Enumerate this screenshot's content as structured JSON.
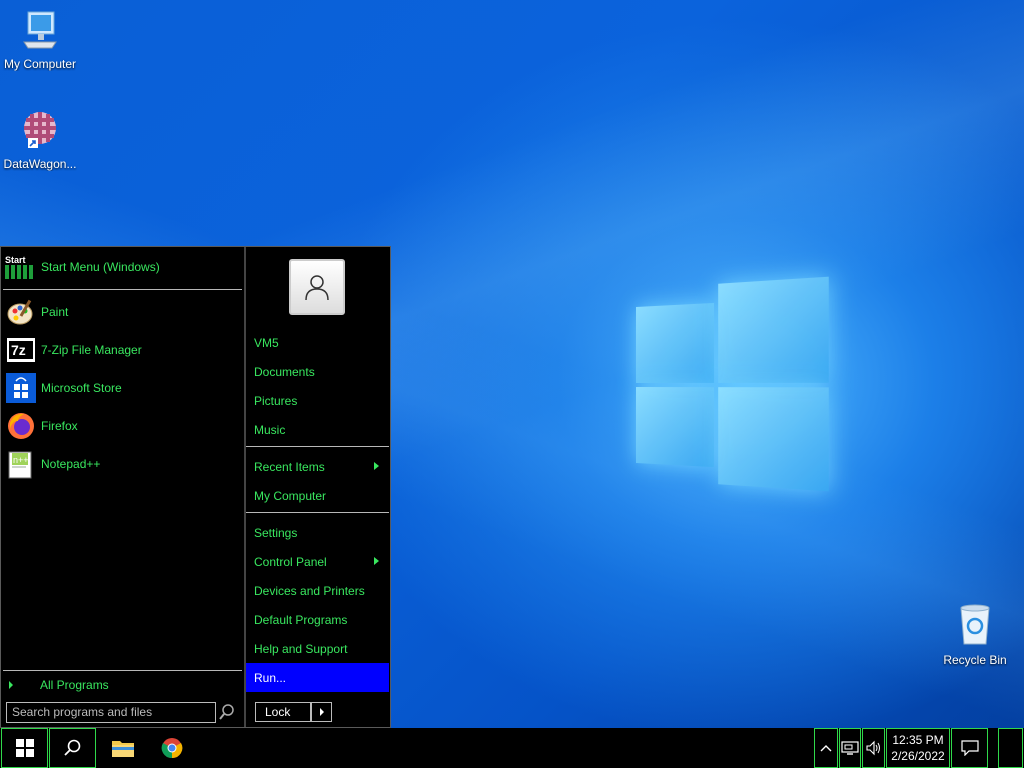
{
  "desktop": {
    "icons": [
      {
        "label": "My Computer",
        "icon": "computer-icon"
      },
      {
        "label": "DataWagon...",
        "icon": "datawagon-shortcut-icon"
      },
      {
        "label": "Recycle Bin",
        "icon": "recycle-bin-icon"
      }
    ]
  },
  "start_menu": {
    "header": {
      "icon_text": "Start",
      "label": "Start Menu (Windows)"
    },
    "pinned": [
      {
        "label": "Paint",
        "icon": "paint-icon"
      },
      {
        "label": "7-Zip File Manager",
        "icon": "7zip-icon"
      },
      {
        "label": "Microsoft Store",
        "icon": "store-icon"
      },
      {
        "label": "Firefox",
        "icon": "firefox-icon"
      },
      {
        "label": "Notepad++",
        "icon": "notepadpp-icon"
      }
    ],
    "all_programs": "All Programs",
    "search": {
      "placeholder": "Search programs and files"
    },
    "user": {
      "name": "VM5"
    },
    "right_items": [
      "Documents",
      "Pictures",
      "Music",
      "Recent Items",
      "My Computer",
      "Settings",
      "Control Panel",
      "Devices and Printers",
      "Default Programs",
      "Help and Support",
      "Run..."
    ],
    "lock_label": "Lock",
    "colors": {
      "text": "#39e75f",
      "highlight": "#0000ff",
      "background": "#000000"
    }
  },
  "taskbar": {
    "apps": [
      "start-button",
      "search-icon",
      "file-explorer-icon",
      "chrome-icon"
    ],
    "clock": {
      "time": "12:35 PM",
      "date": "2/26/2022"
    },
    "tray": [
      "chevron-up-icon",
      "network-icon",
      "volume-icon"
    ],
    "notification": "action-center-icon"
  }
}
